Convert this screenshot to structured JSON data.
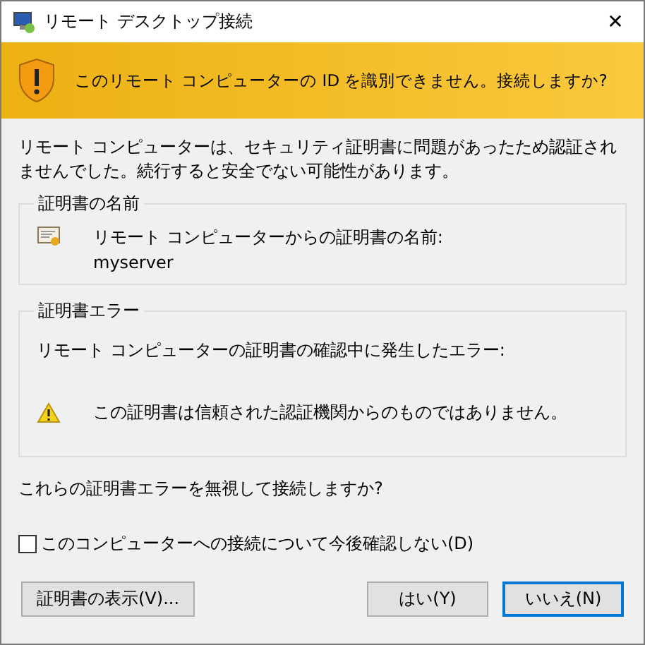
{
  "window": {
    "title": "リモート デスクトップ接続",
    "close": "✕"
  },
  "banner": {
    "text": "このリモート コンピューターの ID を識別できません。接続しますか?"
  },
  "intro": "リモート コンピューターは、セキュリティ証明書に問題があったため認証されませんでした。続行すると安全でない可能性があります。",
  "groups": [
    {
      "title": "証明書の名前",
      "kind": "certificate",
      "label": "リモート コンピューターからの証明書の名前:",
      "value": "myserver"
    },
    {
      "title": "証明書エラー",
      "kind": "errors",
      "label": "リモート コンピューターの証明書の確認中に発生したエラー:",
      "value": "この証明書は信頼された認証機関からのものではありません。"
    }
  ],
  "question": "これらの証明書エラーを無視して接続しますか?",
  "checkbox": {
    "label": "このコンピューターへの接続について今後確認しない(D)",
    "checked": false
  },
  "buttons": [
    {
      "label": "証明書の表示(V)...",
      "default": false
    },
    {
      "label": "はい(Y)",
      "default": false
    },
    {
      "label": "いいえ(N)",
      "default": true
    }
  ]
}
